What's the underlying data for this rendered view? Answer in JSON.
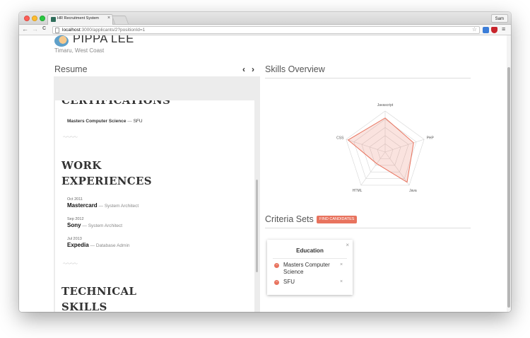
{
  "browser": {
    "tab_title": "HR Recruitment System",
    "tab_close": "×",
    "user": "Sam",
    "url_host": "localhost",
    "url_path": ":3000/applicants/2?positionId=1",
    "back": "←",
    "forward": "→",
    "reload": "C",
    "star": "☆",
    "menu": "≡"
  },
  "applicant": {
    "name": "PIPPA LEE",
    "location": "Timaru, West Coast"
  },
  "resume": {
    "title": "Resume",
    "prev": "‹",
    "next": "›",
    "certifications_heading": "CERTIFICATIONS",
    "certification": {
      "degree": "Masters Computer Science",
      "sep": " — ",
      "school": "SFU"
    },
    "divider": "〜〜〜〜",
    "work_heading": "WORK EXPERIENCES",
    "jobs": [
      {
        "date": "Oct 2011",
        "company": "Mastercard",
        "sep": " — ",
        "role": "System Architect"
      },
      {
        "date": "Sep 2012",
        "company": "Sony",
        "sep": " — ",
        "role": "System Architect"
      },
      {
        "date": "Jul 2013",
        "company": "Expedia",
        "sep": " — ",
        "role": "Database Admin"
      }
    ],
    "technical_heading": "TECHNICAL SKILLS"
  },
  "skills": {
    "title": "Skills Overview",
    "chart_data": {
      "type": "radar",
      "axes": [
        "Javascript",
        "PHP",
        "Java",
        "HTML",
        "CSS"
      ],
      "series": [
        {
          "values": [
            0.83,
            0.73,
            0.91,
            0.35,
            0.95
          ]
        }
      ],
      "rings": 5,
      "colors": {
        "series_stroke": "#e8735e",
        "series_fill": "rgba(232,115,94,0.2)",
        "grid": "#d6d6d6"
      }
    }
  },
  "criteria": {
    "title": "Criteria Sets",
    "find_button": "FIND CANDIDATES",
    "card": {
      "title": "Education",
      "close": "×",
      "items": [
        {
          "label": "Masters Computer Science",
          "remove": "×",
          "icon": "minus"
        },
        {
          "label": "SFU",
          "remove": "×",
          "icon": "minus"
        }
      ]
    }
  }
}
